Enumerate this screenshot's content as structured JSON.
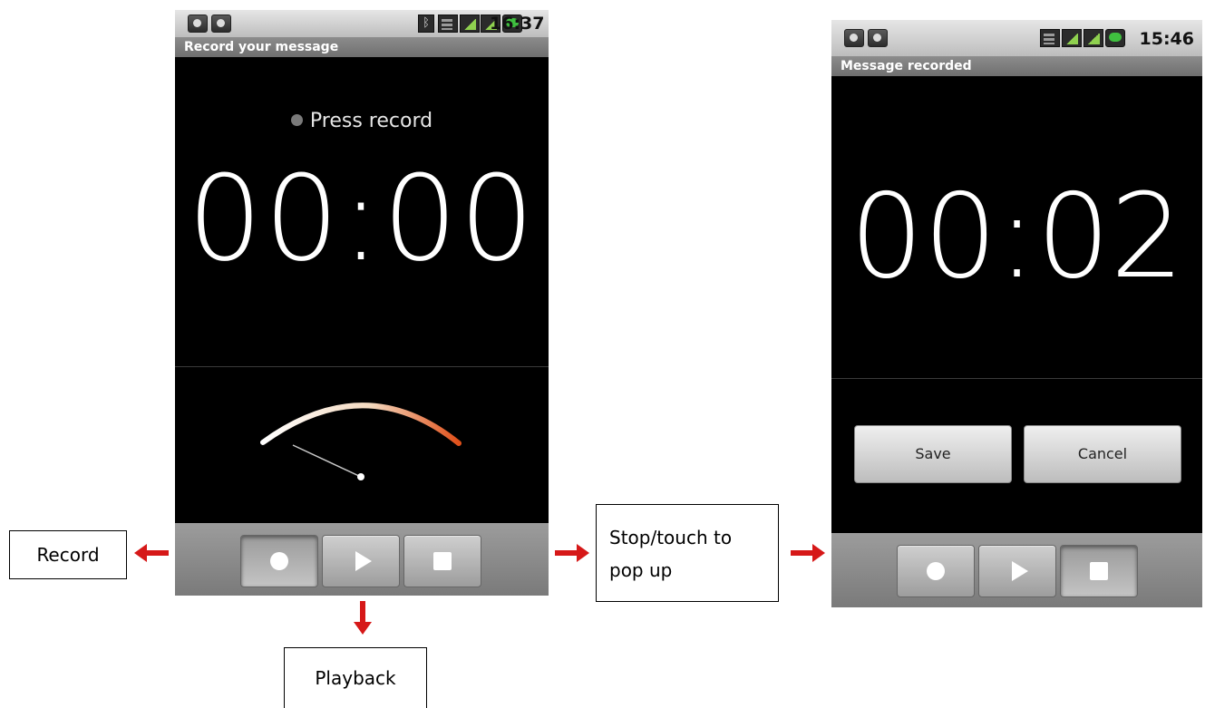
{
  "screen_left": {
    "status_time": "16:37",
    "title": "Record your message",
    "hint_text": "Press record",
    "timer": "00:00",
    "controls": [
      "record",
      "play",
      "stop"
    ]
  },
  "screen_right": {
    "status_time": "15:46",
    "title": "Message recorded",
    "timer": "00:02",
    "save_label": "Save",
    "cancel_label": "Cancel",
    "controls": [
      "record",
      "play",
      "stop"
    ]
  },
  "annotations": {
    "record": "Record",
    "playback": "Playback",
    "stop_line1": "Stop/touch to",
    "stop_line2": "pop up"
  },
  "colors": {
    "arrow": "#d61818",
    "meter_start": "#ffffff",
    "meter_end": "#e0501a"
  },
  "icons": [
    "usb-icon",
    "android-icon",
    "bluetooth-icon",
    "wifi-icon",
    "signal-icon",
    "battery-icon",
    "record-icon",
    "play-icon",
    "stop-icon"
  ]
}
